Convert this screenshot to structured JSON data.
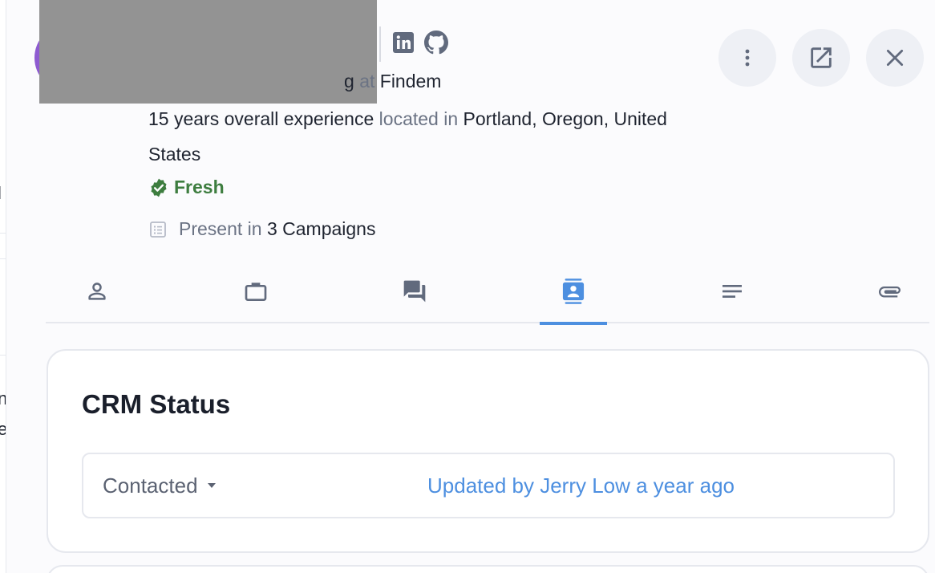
{
  "left_strip": {
    "fragments": [
      "l",
      "n",
      "e"
    ]
  },
  "profile": {
    "title_suffix": "g",
    "at_word": "at",
    "company": "Findem",
    "experience": "15 years overall experience",
    "located_word": "located in",
    "location": "Portland, Oregon, United States",
    "freshness": "Fresh",
    "campaigns_prefix": "Present in",
    "campaigns_value": "3 Campaigns"
  },
  "social": {
    "icons": [
      "linkedin-icon",
      "github-icon"
    ]
  },
  "header_actions": [
    "more-vertical-icon",
    "open-external-icon",
    "close-icon"
  ],
  "tabs": [
    {
      "icon": "person-icon",
      "active": false
    },
    {
      "icon": "briefcase-icon",
      "active": false
    },
    {
      "icon": "chat-icon",
      "active": false
    },
    {
      "icon": "contact-card-icon",
      "active": true
    },
    {
      "icon": "notes-icon",
      "active": false
    },
    {
      "icon": "paperclip-icon",
      "active": false
    }
  ],
  "crm": {
    "title": "CRM Status",
    "status": "Contacted",
    "updated": "Updated by Jerry Low a year ago"
  },
  "colors": {
    "accent": "#4d8fe0",
    "fresh_green": "#3d7d3f",
    "icon_gray": "#616a7d",
    "muted_text": "#6b7384",
    "avatar_purple": "#8e5bd1"
  }
}
